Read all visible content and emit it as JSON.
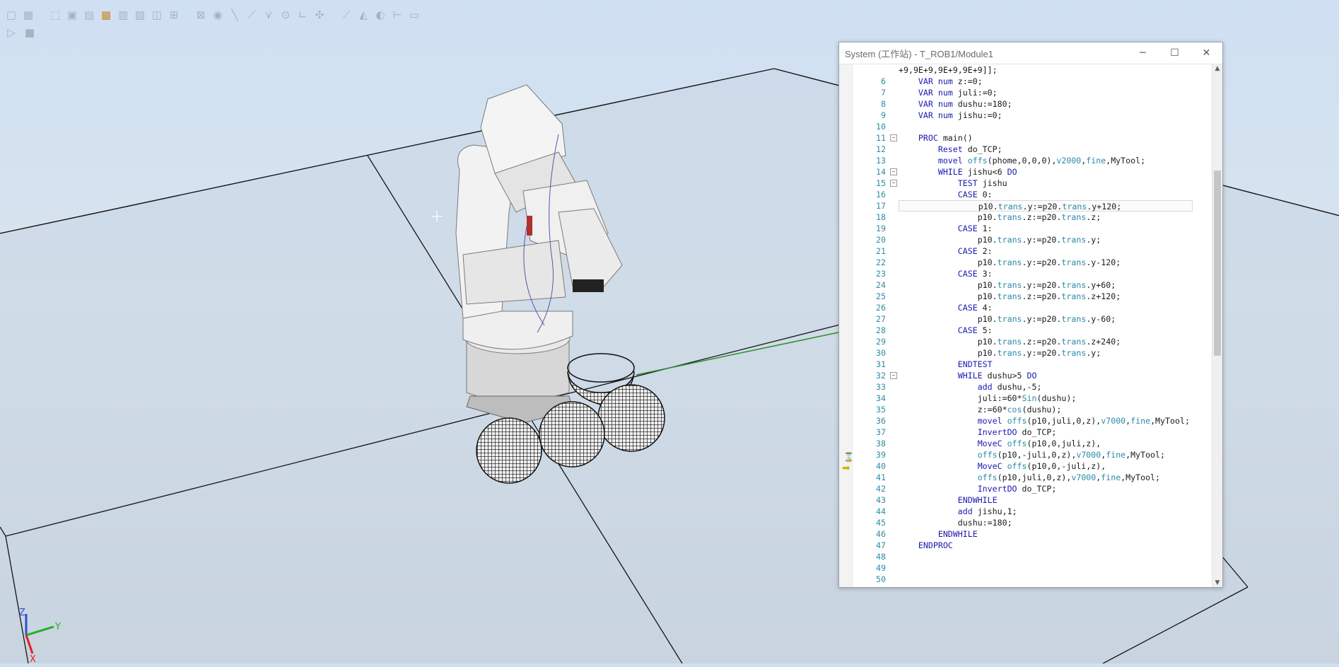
{
  "toolbar": {
    "icons": [
      "frame-icon",
      "frame2-icon",
      "select-icon",
      "select-body-icon",
      "select-part-icon",
      "snap-icon",
      "snap2-icon",
      "grid-icon",
      "circle-icon",
      "line-icon",
      "line2-icon",
      "fork-icon",
      "dot-icon",
      "angle-icon",
      "move-icon",
      "pin-icon",
      "link-icon",
      "gear-icon",
      "ruler-icon",
      "window-icon"
    ],
    "row2_icons": [
      "play-icon",
      "stop-icon"
    ]
  },
  "code_window": {
    "title": "System (工作站) - T_ROB1/Module1",
    "controls": {
      "minimize": "─",
      "maximize": "☐",
      "close": "✕"
    },
    "lines": [
      {
        "num": "",
        "code": "+9,9E+9,9E+9,9E+9]];"
      },
      {
        "num": "6",
        "code": "    VAR num z:=0;"
      },
      {
        "num": "7",
        "code": "    VAR num juli:=0;"
      },
      {
        "num": "8",
        "code": "    VAR num dushu:=180;"
      },
      {
        "num": "9",
        "code": "    VAR num jishu:=0;"
      },
      {
        "num": "10",
        "code": ""
      },
      {
        "num": "11",
        "code": "    PROC main()"
      },
      {
        "num": "12",
        "code": "        Reset do_TCP;"
      },
      {
        "num": "13",
        "code": "        movel offs(phome,0,0,0),v2000,fine,MyTool;"
      },
      {
        "num": "14",
        "code": "        WHILE jishu<6 DO"
      },
      {
        "num": "15",
        "code": "            TEST jishu"
      },
      {
        "num": "16",
        "code": "            CASE 0:"
      },
      {
        "num": "17",
        "code": "                p10.trans.y:=p20.trans.y+120;"
      },
      {
        "num": "18",
        "code": "                p10.trans.z:=p20.trans.z;"
      },
      {
        "num": "19",
        "code": "            CASE 1:"
      },
      {
        "num": "20",
        "code": "                p10.trans.y:=p20.trans.y;"
      },
      {
        "num": "21",
        "code": "            CASE 2:"
      },
      {
        "num": "22",
        "code": "                p10.trans.y:=p20.trans.y-120;"
      },
      {
        "num": "23",
        "code": "            CASE 3:"
      },
      {
        "num": "24",
        "code": "                p10.trans.y:=p20.trans.y+60;"
      },
      {
        "num": "25",
        "code": "                p10.trans.z:=p20.trans.z+120;"
      },
      {
        "num": "26",
        "code": "            CASE 4:"
      },
      {
        "num": "27",
        "code": "                p10.trans.y:=p20.trans.y-60;"
      },
      {
        "num": "28",
        "code": "            CASE 5:"
      },
      {
        "num": "29",
        "code": "                p10.trans.z:=p20.trans.z+240;"
      },
      {
        "num": "30",
        "code": "                p10.trans.y:=p20.trans.y;"
      },
      {
        "num": "31",
        "code": "            ENDTEST"
      },
      {
        "num": "32",
        "code": "            WHILE dushu>5 DO"
      },
      {
        "num": "33",
        "code": "                add dushu,-5;"
      },
      {
        "num": "34",
        "code": "                juli:=60*Sin(dushu);"
      },
      {
        "num": "35",
        "code": "                z:=60*cos(dushu);"
      },
      {
        "num": "36",
        "code": "                movel offs(p10,juli,0,z),v7000,fine,MyTool;"
      },
      {
        "num": "37",
        "code": "                InvertDO do_TCP;"
      },
      {
        "num": "38",
        "code": "                MoveC offs(p10,0,juli,z),"
      },
      {
        "num": "39",
        "code": "                offs(p10,-juli,0,z),v7000,fine,MyTool;"
      },
      {
        "num": "40",
        "code": "                MoveC offs(p10,0,-juli,z),"
      },
      {
        "num": "41",
        "code": "                offs(p10,juli,0,z),v7000,fine,MyTool;"
      },
      {
        "num": "42",
        "code": "                InvertDO do_TCP;"
      },
      {
        "num": "43",
        "code": "            ENDWHILE"
      },
      {
        "num": "44",
        "code": "            add jishu,1;"
      },
      {
        "num": "45",
        "code": "            dushu:=180;"
      },
      {
        "num": "46",
        "code": "        ENDWHILE"
      },
      {
        "num": "47",
        "code": "    ENDPROC"
      },
      {
        "num": "48",
        "code": ""
      },
      {
        "num": "49",
        "code": ""
      },
      {
        "num": "50",
        "code": ""
      }
    ],
    "fold_lines": [
      "11",
      "14",
      "15",
      "32"
    ],
    "current_line": "17"
  },
  "axis": {
    "z": "Z",
    "y": "Y",
    "x": "X"
  },
  "colors": {
    "axis_x": "#e02020",
    "axis_y": "#22b022",
    "axis_z": "#2b4fd8",
    "keyword": "#1a1ab0",
    "function": "#2a8aa8"
  }
}
